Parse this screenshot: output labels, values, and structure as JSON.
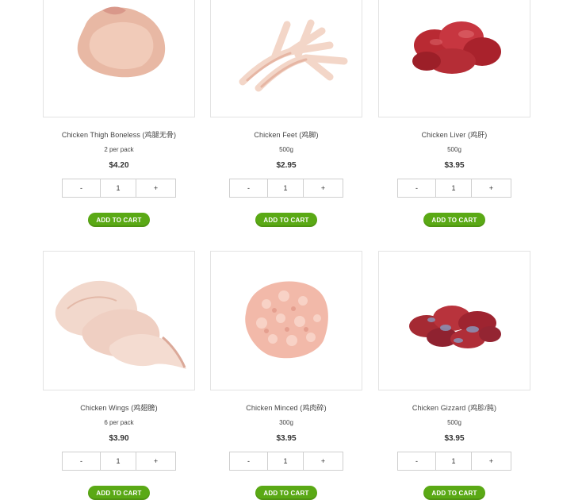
{
  "products": [
    {
      "name": "Chicken Thigh Boneless (鸡腿无骨)",
      "unit": "2 per pack",
      "price": "$4.20",
      "qty": "1",
      "minus": "-",
      "plus": "+",
      "cta": "ADD TO CART",
      "image_icon": "chicken-thigh-image"
    },
    {
      "name": "Chicken Feet (鸡脚)",
      "unit": "500g",
      "price": "$2.95",
      "qty": "1",
      "minus": "-",
      "plus": "+",
      "cta": "ADD TO CART",
      "image_icon": "chicken-feet-image"
    },
    {
      "name": "Chicken Liver (鸡肝)",
      "unit": "500g",
      "price": "$3.95",
      "qty": "1",
      "minus": "-",
      "plus": "+",
      "cta": "ADD TO CART",
      "image_icon": "chicken-liver-image"
    },
    {
      "name": "Chicken Wings (鸡翅膀)",
      "unit": "6 per pack",
      "price": "$3.90",
      "qty": "1",
      "minus": "-",
      "plus": "+",
      "cta": "ADD TO CART",
      "image_icon": "chicken-wings-image"
    },
    {
      "name": "Chicken Minced (鸡肉碎)",
      "unit": "300g",
      "price": "$3.95",
      "qty": "1",
      "minus": "-",
      "plus": "+",
      "cta": "ADD TO CART",
      "image_icon": "chicken-minced-image"
    },
    {
      "name": "Chicken Gizzard (鸡胗/肫)",
      "unit": "500g",
      "price": "$3.95",
      "qty": "1",
      "minus": "-",
      "plus": "+",
      "cta": "ADD TO CART",
      "image_icon": "chicken-gizzard-image"
    }
  ],
  "colors": {
    "button": "#5aa915",
    "border": "#e3e3e3"
  }
}
